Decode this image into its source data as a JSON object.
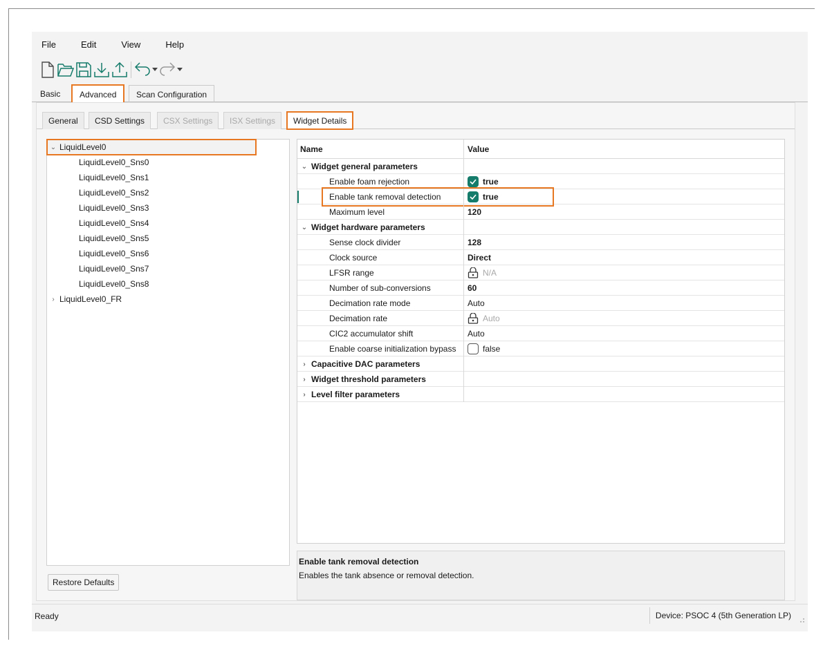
{
  "menu": [
    "File",
    "Edit",
    "View",
    "Help"
  ],
  "toolbar": {
    "icons": [
      "new-file-icon",
      "open-folder-icon",
      "save-icon",
      "import-icon",
      "export-icon",
      "undo-icon",
      "redo-icon"
    ],
    "accent_color": "#157b6a"
  },
  "top_tabs": [
    {
      "label": "Basic"
    },
    {
      "label": "Advanced"
    },
    {
      "label": "Scan Configuration"
    }
  ],
  "sub_tabs": [
    {
      "label": "General",
      "disabled": false
    },
    {
      "label": "CSD Settings",
      "disabled": false
    },
    {
      "label": "CSX Settings",
      "disabled": true
    },
    {
      "label": "ISX Settings",
      "disabled": true
    },
    {
      "label": "Widget Details",
      "disabled": false
    }
  ],
  "tree": {
    "root": "LiquidLevel0",
    "children": [
      "LiquidLevel0_Sns0",
      "LiquidLevel0_Sns1",
      "LiquidLevel0_Sns2",
      "LiquidLevel0_Sns3",
      "LiquidLevel0_Sns4",
      "LiquidLevel0_Sns5",
      "LiquidLevel0_Sns6",
      "LiquidLevel0_Sns7",
      "LiquidLevel0_Sns8"
    ],
    "second_root": "LiquidLevel0_FR"
  },
  "restore_button": "Restore Defaults",
  "properties": {
    "col_name": "Name",
    "col_value": "Value",
    "groups": {
      "general": {
        "label": "Widget general parameters",
        "rows": [
          {
            "name": "Enable foam rejection",
            "value": "true"
          },
          {
            "name": "Enable tank removal detection",
            "value": "true"
          },
          {
            "name": "Maximum level",
            "value": "120"
          }
        ]
      },
      "hardware": {
        "label": "Widget hardware parameters",
        "rows": [
          {
            "name": "Sense clock divider",
            "value": "128"
          },
          {
            "name": "Clock source",
            "value": "Direct"
          },
          {
            "name": "LFSR range",
            "value": "N/A"
          },
          {
            "name": "Number of sub-conversions",
            "value": "60"
          },
          {
            "name": "Decimation rate mode",
            "value": "Auto"
          },
          {
            "name": "Decimation rate",
            "value": "Auto"
          },
          {
            "name": "CIC2 accumulator shift",
            "value": "Auto"
          },
          {
            "name": "Enable coarse initialization bypass",
            "value": "false"
          }
        ]
      },
      "cdac": {
        "label": "Capacitive DAC parameters"
      },
      "threshold": {
        "label": "Widget threshold parameters"
      },
      "filter": {
        "label": "Level filter parameters"
      }
    }
  },
  "description": {
    "title": "Enable tank removal detection",
    "text": "Enables the tank absence or removal detection."
  },
  "status": {
    "left": "Ready",
    "device": "Device: PSOC 4 (5th Generation LP)"
  }
}
